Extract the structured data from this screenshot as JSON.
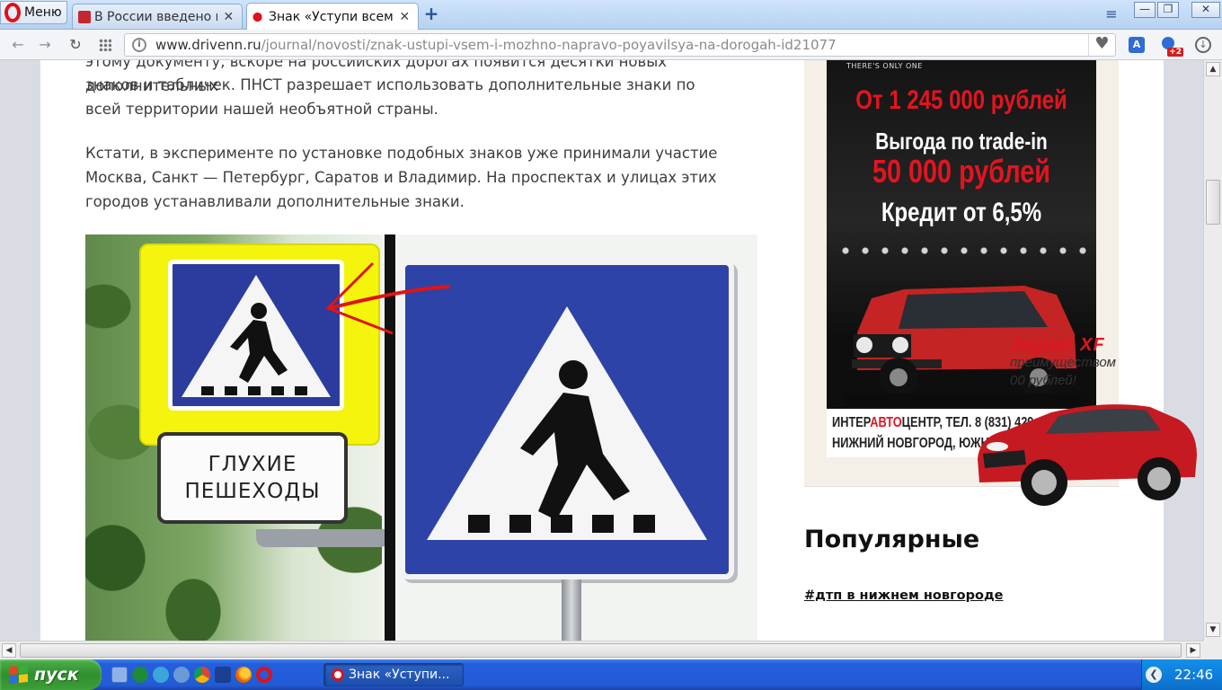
{
  "browser": {
    "menu_label": "Меню",
    "tabs": [
      {
        "title": "В России введено н",
        "active": false
      },
      {
        "title": "Знак «Уступи всем,",
        "active": true
      }
    ],
    "url_domain": "www.drivenn.ru",
    "url_path": "/journal/novosti/znak-ustupi-vsem-i-mozhno-napravo-poyavilsya-na-dorogah-id21077",
    "extension_badge": "+2"
  },
  "article": {
    "paragraph_cut": "этому документу, вскоре на российских дорогах появится десятки новых дополнительных",
    "paragraph_1": "знаков и табличек. ПНСТ разрешает использовать дополнительные знаки по всей территории нашей необъятной страны.",
    "paragraph_2": "Кстати, в эксперименте по установке подобных знаков уже принимали участие Москва, Санкт — Петербург, Саратов и Владимир. На проспектах и улицах этих городов устанавливали дополнительные знаки.",
    "sign_plate_line1": "ГЛУХИЕ",
    "sign_plate_line2": "ПЕШЕХОДЫ"
  },
  "ad_jeep": {
    "tagline": "THERE'S ONLY ONE",
    "price": "От 1 245 000 рублей",
    "benefit_label": "Выгода по trade-in",
    "benefit_value": "50 000 рублей",
    "credit": "Кредит от 6,5%",
    "dealer_prefix": "ИНТЕР",
    "dealer_red": "АВТО",
    "dealer_suffix": "ЦЕНТР, ТЕЛ. 8 (831) 429-20-20",
    "address": "НИЖНИЙ НОВГОРОД, ЮЖНОЕ ШОССЕ, 1"
  },
  "ad_jaguar": {
    "brand": "Jaguar XF",
    "line2": "преимуществом",
    "line3": "00 рублей!"
  },
  "sidebar": {
    "popular_title": "Популярные",
    "popular_link": "#дтп в нижнем новгороде"
  },
  "taskbar": {
    "start_label": "пуск",
    "active_task": "Знак «Уступи...",
    "clock": "22:46"
  },
  "colors": {
    "accent_red": "#e3141f",
    "sign_blue": "#2e43a8",
    "sign_yellow": "#f4f40d",
    "xp_blue": "#245edb",
    "xp_green": "#3c9f37"
  }
}
